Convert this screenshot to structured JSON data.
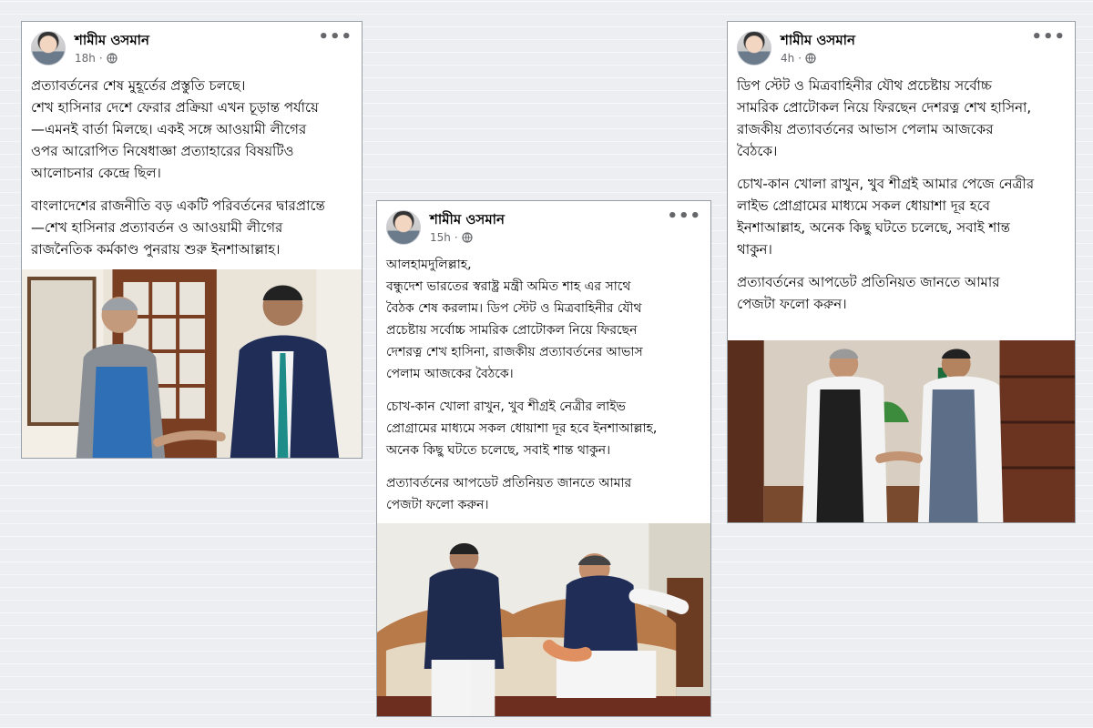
{
  "posts": [
    {
      "author": "শামীম ওসমান",
      "time": "18h",
      "paragraphs": [
        "প্রত্যাবর্তনের শেষ মুহূর্তের প্রস্তুতি চলছে।\nশেখ হাসিনার দেশে ফেরার প্রক্রিয়া এখন চূড়ান্ত পর্যায়ে\n—এমনই বার্তা মিলছে। একই সঙ্গে আওয়ামী লীগের\nওপর আরোপিত নিষেধাজ্ঞা প্রত্যাহারের বিষয়টিও\nআলোচনার কেন্দ্রে ছিল।",
        "বাংলাদেশের রাজনীতি বড় একটি পরিবর্তনের দ্বারপ্রান্তে\n—শেখ হাসিনার প্রত্যাবর্তন ও আওয়ামী লীগের\nরাজনৈতিক কর্মকাণ্ড পুনরায় শুরু ইনশাআল্লাহ।"
      ]
    },
    {
      "author": "শামীম ওসমান",
      "time": "15h",
      "paragraphs": [
        "আলহামদুলিল্লাহ,\nবন্ধুদেশ ভারতের স্বরাষ্ট্র মন্ত্রী অমিত শাহ এর সাথে\nবৈঠক শেষ করলাম। ডিপ স্টেট ও মিত্রবাহিনীর যৌথ\nপ্রচেষ্টায় সর্বোচ্চ সামরিক প্রোটোকল নিয়ে ফিরছেন\nদেশরত্ন শেখ হাসিনা, রাজকীয় প্রত্যাবর্তনের আভাস\nপেলাম আজকের বৈঠকে।",
        "চোখ-কান খোলা রাখুন, খুব শীগ্রই নেত্রীর লাইভ\nপ্রোগ্রামের মাধ্যমে সকল ধোয়াশা দূর হবে ইনশাআল্লাহ,\nঅনেক কিছু ঘটতে চলেছে, সবাই শান্ত থাকুন।",
        "প্রত্যাবর্তনের আপডেট প্রতিনিয়ত জানতে আমার\nপেজটা ফলো করুন।"
      ]
    },
    {
      "author": "শামীম ওসমান",
      "time": "4h",
      "paragraphs": [
        "ডিপ স্টেট ও মিত্রবাহিনীর যৌথ প্রচেষ্টায় সর্বোচ্চ\nসামরিক প্রোটোকল নিয়ে ফিরছেন দেশরত্ন শেখ হাসিনা,\nরাজকীয় প্রত্যাবর্তনের আভাস পেলাম আজকের\nবৈঠকে।",
        "চোখ-কান খোলা রাখুন, খুব শীগ্রই আমার পেজে নেত্রীর\nলাইভ প্রোগ্রামের মাধ্যমে সকল ধোয়াশা দূর হবে\nইনশাআল্লাহ, অনেক কিছু ঘটতে চলেছে, সবাই শান্ত\nথাকুন।",
        "প্রত্যাবর্তনের আপডেট প্রতিনিয়ত জানতে আমার\nপেজটা ফলো করুন।"
      ]
    }
  ],
  "more_glyph": "•••"
}
